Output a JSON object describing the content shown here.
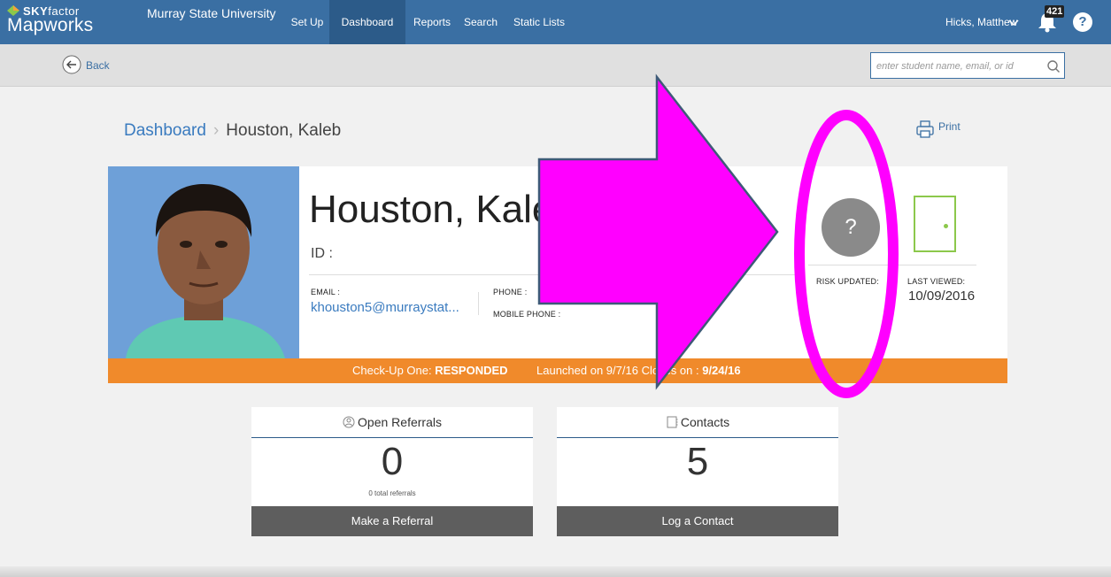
{
  "brand": {
    "sky": "SKY",
    "sky_rest": "factor",
    "product": "Mapworks"
  },
  "header": {
    "university": "Murray State University",
    "nav": [
      "Set Up",
      "Dashboard",
      "Reports",
      "Search",
      "Static Lists"
    ],
    "active_nav": "Dashboard",
    "user": "Hicks, Matthew",
    "notification_count": "421",
    "help_symbol": "?"
  },
  "subbar": {
    "back_label": "Back",
    "search_placeholder": "enter student name, email, or id"
  },
  "breadcrumb": {
    "root": "Dashboard",
    "sep": "›",
    "current": "Houston, Kaleb"
  },
  "print_label": "Print",
  "student": {
    "name": "Houston, Kaleb",
    "id_label": "ID :",
    "email_label": "EMAIL :",
    "email_value": "khouston5@murraystat...",
    "phone_label": "PHONE :",
    "mobile_label": "MOBILE PHONE :",
    "risk_symbol": "?",
    "risk_label": "RISK UPDATED:",
    "last_viewed_label": "LAST VIEWED:",
    "last_viewed_value": "10/09/2016"
  },
  "checkup": {
    "prefix": "Check-Up One: ",
    "status": "RESPONDED",
    "launched": "Launched on 9/7/16",
    "closes_prefix": "Closes on : ",
    "closes_date": "9/24/16"
  },
  "widgets": {
    "referrals": {
      "title": "Open Referrals",
      "count": "0",
      "sub": "0 total referrals",
      "button": "Make a Referral"
    },
    "contacts": {
      "title": "Contacts",
      "count": "5",
      "button": "Log a Contact"
    }
  },
  "colors": {
    "nav": "#3a6fa3",
    "accent_orange": "#f08a2b",
    "annotation_magenta": "#ff00ff",
    "door_green": "#8cc84b"
  }
}
